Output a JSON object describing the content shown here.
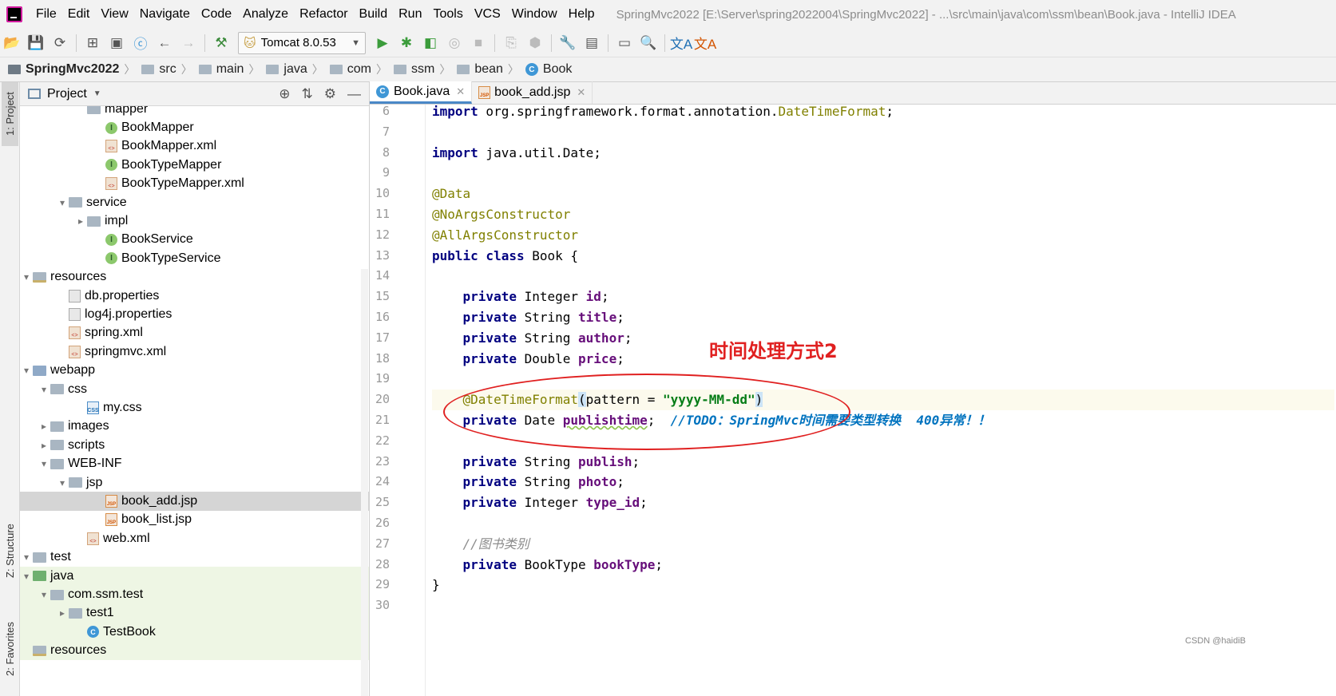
{
  "menu": {
    "items": [
      "File",
      "Edit",
      "View",
      "Navigate",
      "Code",
      "Analyze",
      "Refactor",
      "Build",
      "Run",
      "Tools",
      "VCS",
      "Window",
      "Help"
    ],
    "window_title": "SpringMvc2022 [E:\\Server\\spring2022004\\SpringMvc2022] - ...\\src\\main\\java\\com\\ssm\\bean\\Book.java - IntelliJ IDEA"
  },
  "toolbar": {
    "run_config": "Tomcat 8.0.53"
  },
  "breadcrumb": [
    "SpringMvc2022",
    "src",
    "main",
    "java",
    "com",
    "ssm",
    "bean",
    "Book"
  ],
  "side_strip": {
    "project": "1: Project",
    "structure": "Z: Structure",
    "favorites": "2: Favorites"
  },
  "project_panel": {
    "title": "Project",
    "tree": [
      {
        "label": "mapper",
        "indent": 6,
        "kind": "folder",
        "arrow": ""
      },
      {
        "label": "BookMapper",
        "indent": 7,
        "kind": "interface",
        "arrow": ""
      },
      {
        "label": "BookMapper.xml",
        "indent": 7,
        "kind": "xml",
        "arrow": ""
      },
      {
        "label": "BookTypeMapper",
        "indent": 7,
        "kind": "interface",
        "arrow": ""
      },
      {
        "label": "BookTypeMapper.xml",
        "indent": 7,
        "kind": "xml",
        "arrow": ""
      },
      {
        "label": "service",
        "indent": 5,
        "kind": "folder",
        "arrow": "▾"
      },
      {
        "label": "impl",
        "indent": 6,
        "kind": "folder",
        "arrow": "▸"
      },
      {
        "label": "BookService",
        "indent": 7,
        "kind": "interface",
        "arrow": ""
      },
      {
        "label": "BookTypeService",
        "indent": 7,
        "kind": "interface",
        "arrow": ""
      },
      {
        "label": "resources",
        "indent": 3,
        "kind": "res",
        "arrow": "▾"
      },
      {
        "label": "db.properties",
        "indent": 5,
        "kind": "prop",
        "arrow": ""
      },
      {
        "label": "log4j.properties",
        "indent": 5,
        "kind": "prop",
        "arrow": ""
      },
      {
        "label": "spring.xml",
        "indent": 5,
        "kind": "xml",
        "arrow": ""
      },
      {
        "label": "springmvc.xml",
        "indent": 5,
        "kind": "xml",
        "arrow": ""
      },
      {
        "label": "webapp",
        "indent": 3,
        "kind": "web",
        "arrow": "▾"
      },
      {
        "label": "css",
        "indent": 4,
        "kind": "folder",
        "arrow": "▾"
      },
      {
        "label": "my.css",
        "indent": 6,
        "kind": "css",
        "arrow": ""
      },
      {
        "label": "images",
        "indent": 4,
        "kind": "folder",
        "arrow": "▸"
      },
      {
        "label": "scripts",
        "indent": 4,
        "kind": "folder",
        "arrow": "▸"
      },
      {
        "label": "WEB-INF",
        "indent": 4,
        "kind": "folder",
        "arrow": "▾"
      },
      {
        "label": "jsp",
        "indent": 5,
        "kind": "folder",
        "arrow": "▾"
      },
      {
        "label": "book_add.jsp",
        "indent": 7,
        "kind": "jsp",
        "arrow": "",
        "selected": true
      },
      {
        "label": "book_list.jsp",
        "indent": 7,
        "kind": "jsp",
        "arrow": ""
      },
      {
        "label": "web.xml",
        "indent": 6,
        "kind": "xml",
        "arrow": ""
      },
      {
        "label": "test",
        "indent": 2,
        "kind": "folder",
        "arrow": "▾"
      },
      {
        "label": "java",
        "indent": 3,
        "kind": "src",
        "arrow": "▾",
        "green": true
      },
      {
        "label": "com.ssm.test",
        "indent": 4,
        "kind": "folder",
        "arrow": "▾",
        "green": true
      },
      {
        "label": "test1",
        "indent": 5,
        "kind": "folder",
        "arrow": "▸",
        "green": true
      },
      {
        "label": "TestBook",
        "indent": 6,
        "kind": "testclass",
        "arrow": "",
        "green": true
      },
      {
        "label": "resources",
        "indent": 3,
        "kind": "res",
        "arrow": "",
        "green": true
      }
    ]
  },
  "editor": {
    "tabs": [
      {
        "label": "Book.java",
        "active": true,
        "icon": "C"
      },
      {
        "label": "book_add.jsp",
        "active": false,
        "icon": "JSP"
      }
    ],
    "lines": [
      {
        "n": "6",
        "html": "<span class='kw'>import</span> org.springframework.format.annotation.<span class='ann'>DateTimeFormat</span>;"
      },
      {
        "n": "7",
        "html": ""
      },
      {
        "n": "8",
        "html": "<span class='kw'>import</span> java.util.Date;"
      },
      {
        "n": "9",
        "html": ""
      },
      {
        "n": "10",
        "html": "<span class='ann'>@Data</span>"
      },
      {
        "n": "11",
        "html": "<span class='ann'>@NoArgsConstructor</span>"
      },
      {
        "n": "12",
        "html": "<span class='ann'>@AllArgsConstructor</span>"
      },
      {
        "n": "13",
        "html": "<span class='kw'>public class</span> Book {"
      },
      {
        "n": "14",
        "html": ""
      },
      {
        "n": "15",
        "html": "    <span class='kw'>private</span> Integer <span class='field'>id</span>;"
      },
      {
        "n": "16",
        "html": "    <span class='kw'>private</span> String <span class='field'>title</span>;"
      },
      {
        "n": "17",
        "html": "    <span class='kw'>private</span> String <span class='field'>author</span>;"
      },
      {
        "n": "18",
        "html": "    <span class='kw'>private</span> Double <span class='field'>price</span>;"
      },
      {
        "n": "19",
        "html": ""
      },
      {
        "n": "20",
        "html": "    <span class='ann'>@DateTimeFormat</span><span class='bracket'>(</span>pattern = <span class='str'>\"yyyy-MM-dd\"</span><span class='bracket'>)</span>",
        "hl": true
      },
      {
        "n": "21",
        "html": "    <span class='kw'>private</span> Date <span class='field squiggle'>publishtime</span>;  <span class='todo'>//TODO：SpringMvc时间需要类型转换  400异常！！</span>"
      },
      {
        "n": "22",
        "html": ""
      },
      {
        "n": "23",
        "html": "    <span class='kw'>private</span> String <span class='field'>publish</span>;"
      },
      {
        "n": "24",
        "html": "    <span class='kw'>private</span> String <span class='field'>photo</span>;"
      },
      {
        "n": "25",
        "html": "    <span class='kw'>private</span> Integer <span class='field'>type_id</span>;"
      },
      {
        "n": "26",
        "html": ""
      },
      {
        "n": "27",
        "html": "    <span class='cmt'>//图书类别</span>"
      },
      {
        "n": "28",
        "html": "    <span class='kw'>private</span> BookType <span class='field'>bookType</span>;"
      },
      {
        "n": "29",
        "html": "}"
      },
      {
        "n": "30",
        "html": ""
      }
    ]
  },
  "annotation": "时间处理方式2",
  "watermark": "CSDN @haidiB",
  "colors": {
    "annotation_red": "#e02020",
    "selection": "#d5d5d5",
    "accent": "#4a88c7"
  }
}
